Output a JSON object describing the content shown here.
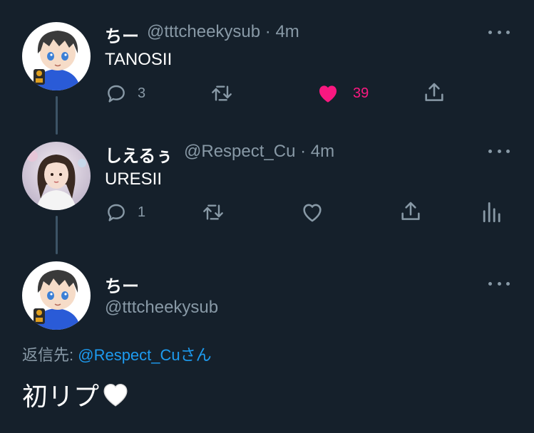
{
  "tweets": [
    {
      "name": "ちー",
      "handle": "@tttcheekysub",
      "time": "4m",
      "text": "TANOSII",
      "reply_count": "3",
      "like_count": "39"
    },
    {
      "name": "しえるぅ",
      "handle": "@Respect_Cu",
      "time": "4m",
      "text": "URESII",
      "reply_count": "1"
    }
  ],
  "main": {
    "name": "ちー",
    "handle": "@tttcheekysub",
    "reply_prefix": "返信先: ",
    "reply_mention": "@Respect_Cu",
    "reply_suffix": "さん",
    "text": "初リプ"
  },
  "separator": " · ",
  "colors": {
    "background": "#15202b",
    "secondary_text": "#8899a6",
    "like": "#f91880",
    "link": "#1d9bf0"
  },
  "icons": [
    "more-icon",
    "reply-icon",
    "retweet-icon",
    "like-icon",
    "share-icon",
    "analytics-icon",
    "white-heart-emoji"
  ]
}
